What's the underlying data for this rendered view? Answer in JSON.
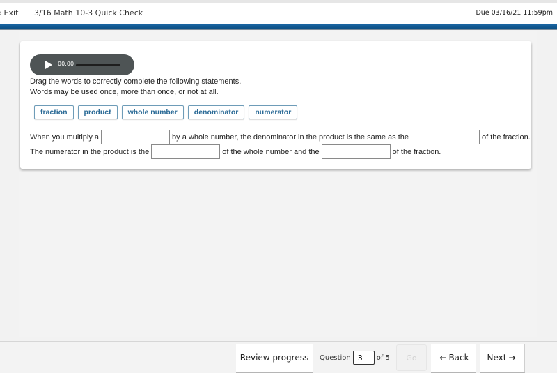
{
  "header": {
    "exit_label": "Exit",
    "exit_icon": "chevron-left",
    "title": "3/16 Math 10-3 Quick Check",
    "due": "Due 03/16/21 11:59pm"
  },
  "audio": {
    "play_icon": "play",
    "time": "00:00",
    "progress": 0
  },
  "question": {
    "instructions_line1": "Drag the words to correctly complete the following statements.",
    "instructions_line2": "Words may be used once, more than once, or not at all.",
    "word_bank": [
      "fraction",
      "product",
      "whole number",
      "denominator",
      "numerator"
    ],
    "sentence1": {
      "part1": "When you multiply a",
      "part2": "by a whole number, the denominator in the product is the same as the",
      "part3": "of the fraction.",
      "blank1_value": "",
      "blank2_value": ""
    },
    "sentence2": {
      "part1": "The numerator in the product is the",
      "part2": "of the whole number and the",
      "part3": "of the fraction.",
      "blank1_value": "",
      "blank2_value": ""
    }
  },
  "footer": {
    "review_label": "Review progress",
    "question_label": "Question",
    "question_value": "3",
    "of_label": "of 5",
    "go_label": "Go",
    "back_label": "Back",
    "back_icon": "arrow-left",
    "next_label": "Next",
    "next_icon": "arrow-right"
  },
  "colors": {
    "header_bar": "#0b4c80",
    "chip_text": "#2a6a96",
    "chip_border": "#6e9cb8",
    "audio_bg": "#4e5455"
  }
}
